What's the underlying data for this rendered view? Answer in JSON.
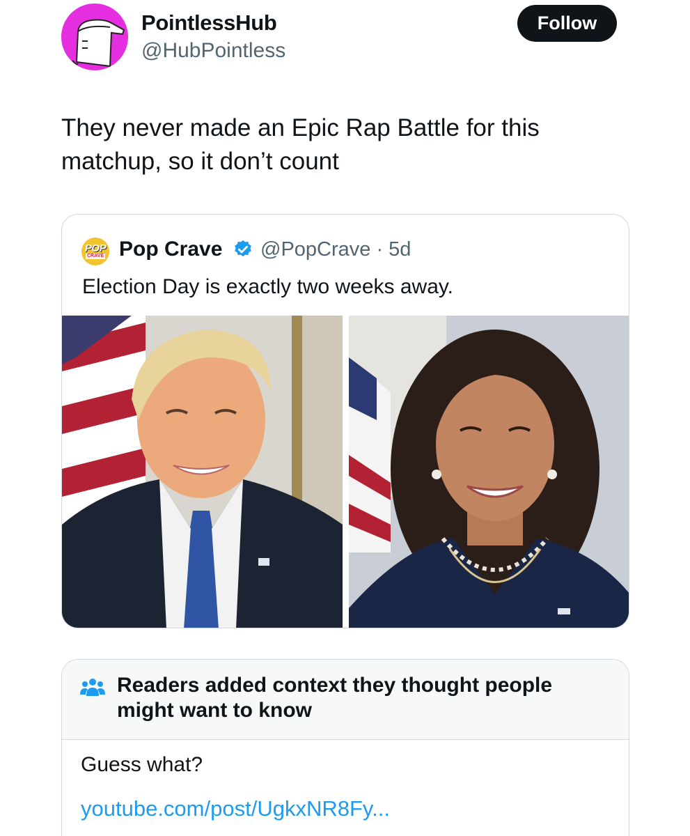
{
  "tweet": {
    "author_name": "PointlessHub",
    "author_handle": "@HubPointless",
    "follow_label": "Follow",
    "text": "They never made an Epic Rap Battle for this matchup, so it don’t count"
  },
  "quoted_tweet": {
    "avatar_text_top": "POP",
    "avatar_text_bottom": "CRAVE",
    "author_name": "Pop Crave",
    "author_handle_time": "@PopCrave · 5d",
    "text": "Election Day is exactly two weeks away."
  },
  "community_note": {
    "title": "Readers added context they thought people might want to know",
    "body": "Guess what?",
    "link": "youtube.com/post/UgkxNR8Fy..."
  },
  "colors": {
    "avatar_bg": "#e52ee0",
    "link": "#1d9bf0",
    "verified": "#1d9bf0",
    "follow_bg": "#0f1419"
  }
}
